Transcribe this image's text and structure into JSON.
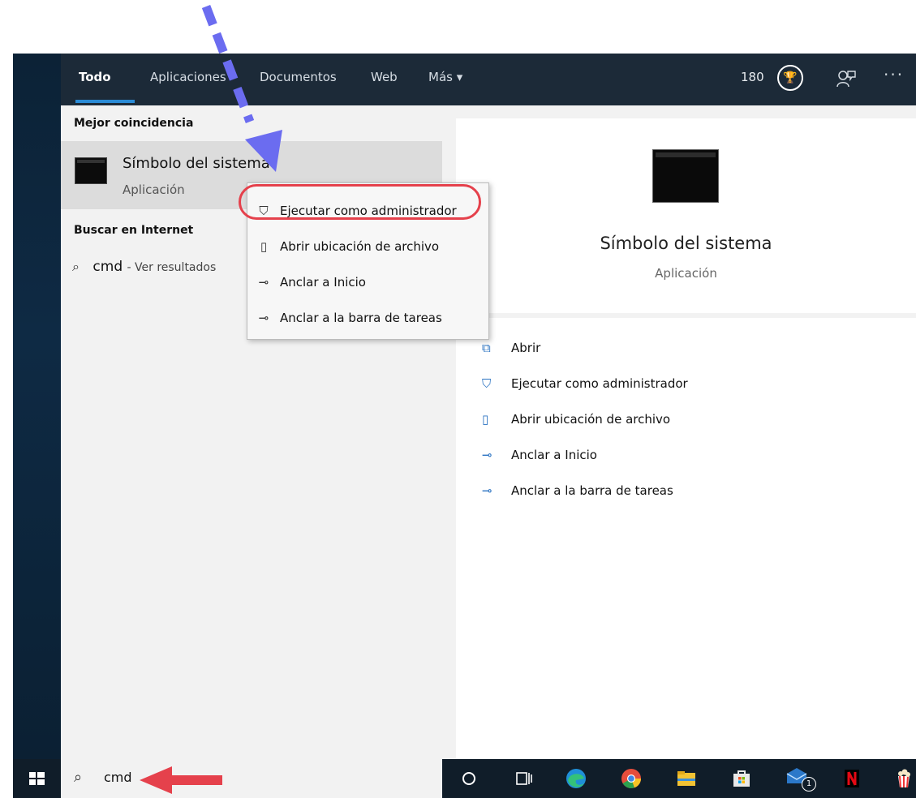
{
  "tabs": [
    {
      "label": "Todo"
    },
    {
      "label": "Aplicaciones"
    },
    {
      "label": "Documentos"
    },
    {
      "label": "Web"
    },
    {
      "label": "Más ▾"
    }
  ],
  "score": "180",
  "sections": {
    "best_match": "Mejor coincidencia",
    "web_search": "Buscar en Internet"
  },
  "best_match": {
    "title": "Símbolo del sistema",
    "subtitle": "Aplicación"
  },
  "web_result": {
    "query": "cmd",
    "hint": "- Ver resultados"
  },
  "context_menu": [
    {
      "label": "Ejecutar como administrador",
      "icon": "shield-window-icon"
    },
    {
      "label": "Abrir ubicación de archivo",
      "icon": "file-location-icon"
    },
    {
      "label": "Anclar a Inicio",
      "icon": "pin-icon"
    },
    {
      "label": "Anclar a la barra de tareas",
      "icon": "pin-icon"
    }
  ],
  "preview": {
    "title": "Símbolo del sistema",
    "subtitle": "Aplicación"
  },
  "actions": [
    {
      "label": "Abrir",
      "icon": "open-icon"
    },
    {
      "label": "Ejecutar como administrador",
      "icon": "shield-window-icon"
    },
    {
      "label": "Abrir ubicación de archivo",
      "icon": "file-location-icon"
    },
    {
      "label": "Anclar a Inicio",
      "icon": "pin-icon"
    },
    {
      "label": "Anclar a la barra de tareas",
      "icon": "pin-icon"
    }
  ],
  "taskbar": {
    "search_text": "cmd",
    "mail_badge": "1",
    "icons": [
      "cortana-icon",
      "task-view-icon",
      "edge-icon",
      "chrome-icon",
      "file-explorer-icon",
      "store-icon",
      "mail-icon",
      "netflix-icon",
      "popcorn-icon"
    ]
  },
  "colors": {
    "highlight_ring": "#e5414c",
    "red_arrow": "#e5414c",
    "blue_arrow": "#6b6cf0",
    "tab_underline": "#2a8bd6"
  }
}
